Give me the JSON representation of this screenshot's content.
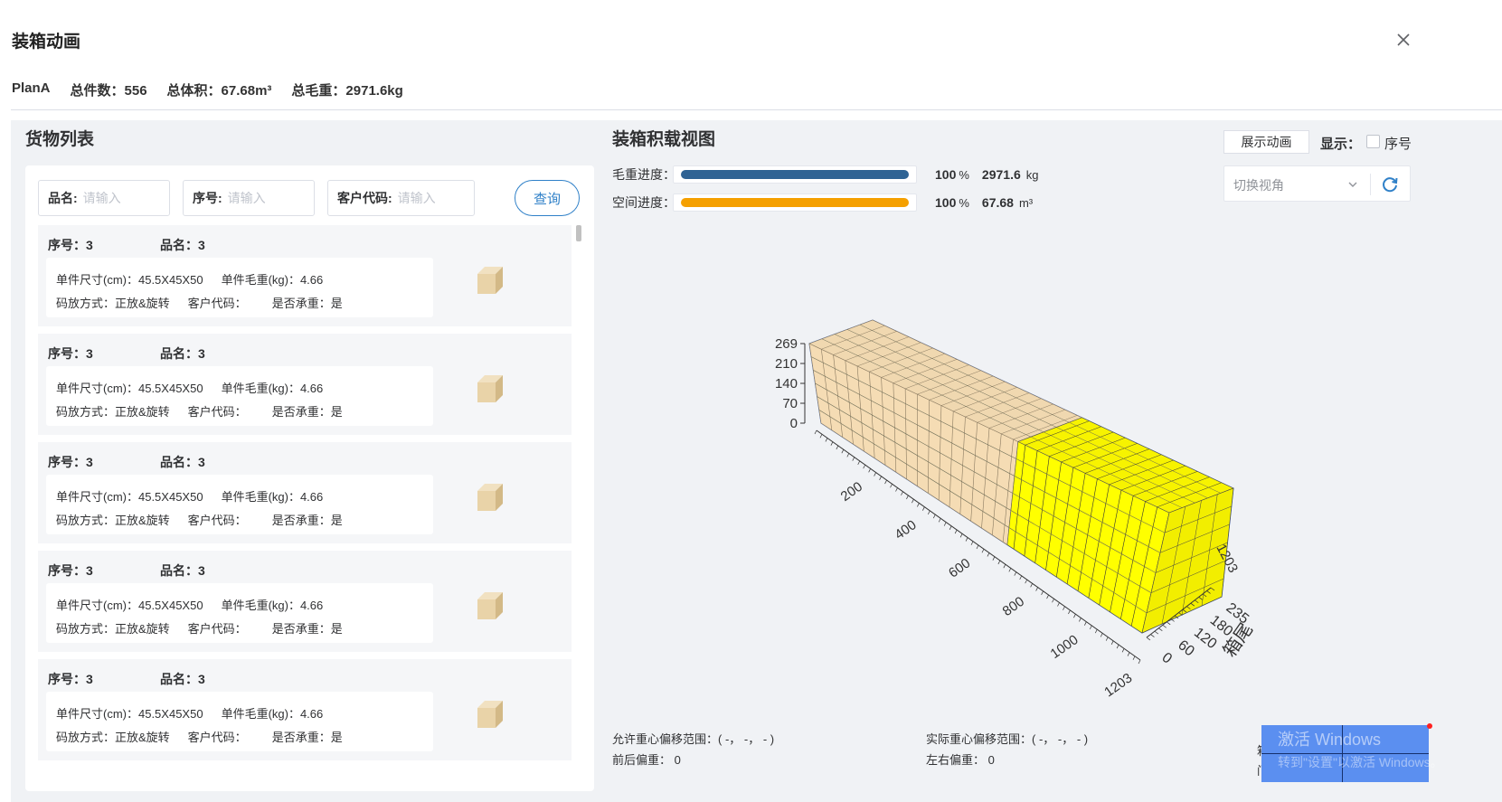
{
  "dialog": {
    "title": "装箱动画"
  },
  "summary": {
    "plan": "PlanA",
    "total_count": "总件数：556",
    "total_volume": "总体积：67.68m³",
    "total_weight": "总毛重：2971.6kg"
  },
  "cargo_list": {
    "title": "货物列表",
    "search": [
      {
        "label": "品名:",
        "placeholder": "请输入"
      },
      {
        "label": "序号:",
        "placeholder": "请输入"
      },
      {
        "label": "客户代码:",
        "placeholder": "请输入"
      }
    ],
    "query_label": "查询",
    "items": [
      {
        "seq": "序号：3",
        "name": "品名：3",
        "size": "单件尺寸(cm)：45.5X45X50",
        "weight": "单件毛重(kg)：4.66",
        "stack": "码放方式：正放&旋转",
        "customer": "客户代码：",
        "bearing": "是否承重：是"
      },
      {
        "seq": "序号：3",
        "name": "品名：3",
        "size": "单件尺寸(cm)：45.5X45X50",
        "weight": "单件毛重(kg)：4.66",
        "stack": "码放方式：正放&旋转",
        "customer": "客户代码：",
        "bearing": "是否承重：是"
      },
      {
        "seq": "序号：3",
        "name": "品名：3",
        "size": "单件尺寸(cm)：45.5X45X50",
        "weight": "单件毛重(kg)：4.66",
        "stack": "码放方式：正放&旋转",
        "customer": "客户代码：",
        "bearing": "是否承重：是"
      },
      {
        "seq": "序号：3",
        "name": "品名：3",
        "size": "单件尺寸(cm)：45.5X45X50",
        "weight": "单件毛重(kg)：4.66",
        "stack": "码放方式：正放&旋转",
        "customer": "客户代码：",
        "bearing": "是否承重：是"
      },
      {
        "seq": "序号：3",
        "name": "品名：3",
        "size": "单件尺寸(cm)：45.5X45X50",
        "weight": "单件毛重(kg)：4.66",
        "stack": "码放方式：正放&旋转",
        "customer": "客户代码：",
        "bearing": "是否承重：是"
      }
    ]
  },
  "loading_view": {
    "title": "装箱积载视图",
    "weight_progress": {
      "label": "毛重进度：",
      "percent": "100",
      "percent_unit": "%",
      "fraction": 1.0,
      "value": "2971.6",
      "unit": "kg",
      "color": "#2f6394"
    },
    "space_progress": {
      "label": "空间进度：",
      "percent": "100",
      "percent_unit": "%",
      "fraction": 1.0,
      "value": "67.68",
      "unit": "m³",
      "color": "#f5a000"
    },
    "animate_button": "展示动画",
    "show_label": "显示：",
    "seq_checkbox_label": "序号",
    "view_select_placeholder": "切换视角",
    "axes": {
      "height_ticks": [
        "269",
        "210",
        "140",
        "70",
        "0"
      ],
      "length_ticks": [
        "200",
        "400",
        "600",
        "800",
        "1000",
        "1203"
      ],
      "width_ticks": [
        "0",
        "60",
        "120",
        "180",
        "235"
      ],
      "rear_length_label": "1203",
      "rear_label": "箱尾"
    },
    "colors": {
      "cargo_a": "#f5dcb4",
      "cargo_b": "#ffff00",
      "container": "#5b87dd"
    }
  },
  "footer": {
    "allowed_cg": "允许重心偏移范围：( -， -， - )",
    "front_back": "前后偏重：  0",
    "actual_cg": "实际重心偏移范围：( -， -， - )",
    "left_right": "左右偏重：  0",
    "door_char1": "箱",
    "door_char2": "门"
  },
  "watermark": {
    "line1": "激活 Windows",
    "line2": "转到\"设置\"以激活 Windows。"
  }
}
